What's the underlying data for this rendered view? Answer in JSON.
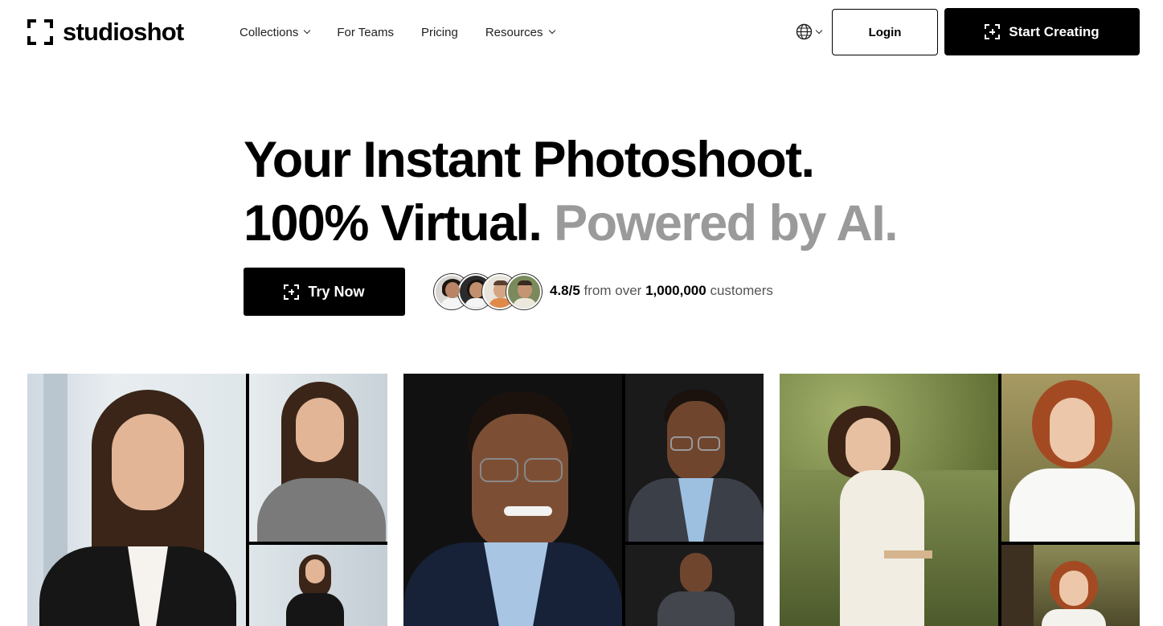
{
  "header": {
    "brand": "studioshot",
    "nav": [
      {
        "label": "Collections",
        "dropdown": true
      },
      {
        "label": "For Teams",
        "dropdown": false
      },
      {
        "label": "Pricing",
        "dropdown": false
      },
      {
        "label": "Resources",
        "dropdown": true
      }
    ],
    "language_icon": "globe-icon",
    "login_label": "Login",
    "cta_label": "Start Creating"
  },
  "hero": {
    "line1": "Your Instant Photoshoot.",
    "line2_main": "100% Virtual.",
    "line2_muted": "Powered by AI.",
    "try_label": "Try Now",
    "rating_score": "4.8/5",
    "rating_mid": "from over",
    "rating_count": "1,000,000",
    "rating_tail": "customers"
  },
  "gallery": [
    {
      "name": "office-woman-portrait"
    },
    {
      "name": "glasses-man-portrait"
    },
    {
      "name": "park-woman-portrait"
    }
  ],
  "colors": {
    "accent": "#000000",
    "muted_text": "#9a9a9a",
    "background": "#ffffff"
  }
}
